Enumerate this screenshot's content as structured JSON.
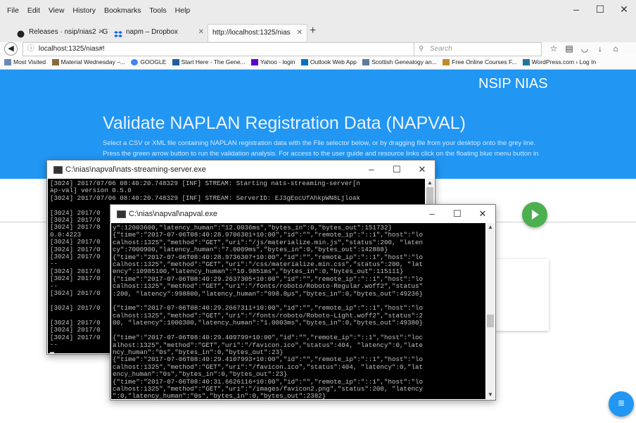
{
  "browser": {
    "menu": [
      "File",
      "Edit",
      "View",
      "History",
      "Bookmarks",
      "Tools",
      "Help"
    ],
    "window_controls": [
      "–",
      "☐",
      "✕"
    ],
    "tabs": [
      {
        "label": "Releases · nsip/nias2 · GitHu",
        "close": "✕",
        "active": false
      },
      {
        "label": "napm – Dropbox",
        "close": "✕",
        "active": false
      },
      {
        "label": "http://localhost:1325/nias",
        "close": "✕",
        "active": true
      }
    ],
    "new_tab": "+",
    "url": "localhost:1325/nias#!",
    "search_placeholder": "Search",
    "bookmarks": [
      "Most Visited",
      "Material Wednesday –...",
      "GOOGLE",
      "Start Here - The Gene...",
      "Yahoo - login",
      "Outlook Web App",
      "Scottish Genealogy an...",
      "Free Online Courses F...",
      "WordPress.com › Log In"
    ]
  },
  "page": {
    "brand": "NSIP NIAS",
    "title": "Validate NAPLAN Registration Data (NAPVAL)",
    "desc_line1": "Select a CSV or XML file containing NAPLAN registration data with the File selector below, or by dragging file from your desktop onto the grey line.",
    "desc_line2": "Press the green arrow button to run the validation analysis. For access to the user guide and resource links click on the floating blue menu button in",
    "fab_icon": "menu-icon",
    "run_icon": "play-icon",
    "colors": {
      "primary": "#2196f3",
      "run": "#4caf50"
    }
  },
  "win1": {
    "title": "C:\\nias\\napval\\nats-streaming-server.exe",
    "lines": [
      "[3024] 2017/07/06 08:40:20.748329 [INF] STREAM: Starting nats-streaming-server[n",
      "ap-val] version 0.5.0",
      "[3024] 2017/07/06 08:40:20.748329 [INF] STREAM: ServerID: EJ3gEocUfAhkpWN8Ljloak",
      "",
      "[3024] 2017/0",
      "[3024] 2017/0",
      "[3024] 2017/0",
      "0.0:4223",
      "[3024] 2017/0",
      "[3024] 2017/0",
      "[3024] 2017/0",
      "--",
      "[3024] 2017/0",
      "[3024] 2017/0",
      "--",
      "[3024] 2017/0",
      "",
      "[3024] 2017/0",
      "",
      "[3024] 2017/0",
      "[3024] 2017/0",
      "[3024] 2017/0",
      "--"
    ]
  },
  "win2": {
    "title": "C:\\nias\\napval\\napval.exe",
    "lines": [
      "y\":12003600,\"latency_human\":\"12.0036ms\",\"bytes_in\":0,\"bytes_out\":151732}",
      "{\"time\":\"2017-07-06T08:40:28.9706301+10:00\",\"id\":\"\",\"remote_ip\":\"::1\",\"host\":\"lo",
      "calhost:1325\",\"method\":\"GET\",\"uri\":\"/js/materialize.min.js\",\"status\":200, \"laten",
      "cy\":7000900,\"latency_human\":\"7.0009ms\",\"bytes_in\":0,\"bytes_out\":142888}",
      "{\"time\":\"2017-07-06T08:40:28.9736307+10:00\",\"id\":\"\",\"remote_ip\":\"::1\",\"host\":\"lo",
      "calhost:1325\",\"method\":\"GET\",\"uri\":\"/css/materialize.min.css\",\"status\":200, \"lat",
      "ency\":10985100,\"latency_human\":\"10.9851ms\",\"bytes_in\":0,\"bytes_out\":115111}",
      "{\"time\":\"2017-07-06T08:40:29.2637305+10:00\",\"id\":\"\",\"remote_ip\":\"::1\",\"host\":\"lo",
      "calhost:1325\",\"method\":\"GET\",\"uri\":\"/fonts/roboto/Roboto-Regular.woff2\",\"status\"",
      ":200, \"latency\":998800,\"latency_human\":\"998.8µs\",\"bytes_in\":0,\"bytes_out\":49236}",
      "",
      "{\"time\":\"2017-07-06T08:40:29.2667311+10:00\",\"id\":\"\",\"remote_ip\":\"::1\",\"host\":\"lo",
      "calhost:1325\",\"method\":\"GET\",\"uri\":\"/fonts/roboto/Roboto-Light.woff2\",\"status\":2",
      "00, \"latency\":1000300,\"latency_human\":\"1.0003ms\",\"bytes_in\":0,\"bytes_out\":49380}",
      "",
      "{\"time\":\"2017-07-06T08:40:29.409799+10:00\",\"id\":\"\",\"remote_ip\":\"::1\",\"host\":\"loc",
      "alhost:1325\",\"method\":\"GET\",\"uri\":\"/favicon.ico\",\"status\":404, \"latency\":0,\"late",
      "ncy_human\":\"0s\",\"bytes_in\":0,\"bytes_out\":23}",
      "{\"time\":\"2017-07-06T08:40:29.4107993+10:00\",\"id\":\"\",\"remote_ip\":\"::1\",\"host\":\"lo",
      "calhost:1325\",\"method\":\"GET\",\"uri\":\"/favicon.ico\",\"status\":404, \"latency\":0,\"lat",
      "ency_human\":\"0s\",\"bytes_in\":0,\"bytes_out\":23}",
      "{\"time\":\"2017-07-06T08:40:31.6626116+10:00\",\"id\":\"\",\"remote_ip\":\"::1\",\"host\":\"lo",
      "calhost:1325\",\"method\":\"GET\",\"uri\":\"/images/favicon2.png\",\"status\":200, \"latency",
      "\":0,\"latency_human\":\"0s\",\"bytes_in\":0,\"bytes_out\":2382}"
    ]
  },
  "window_controls": [
    "–",
    "☐",
    "✕"
  ]
}
